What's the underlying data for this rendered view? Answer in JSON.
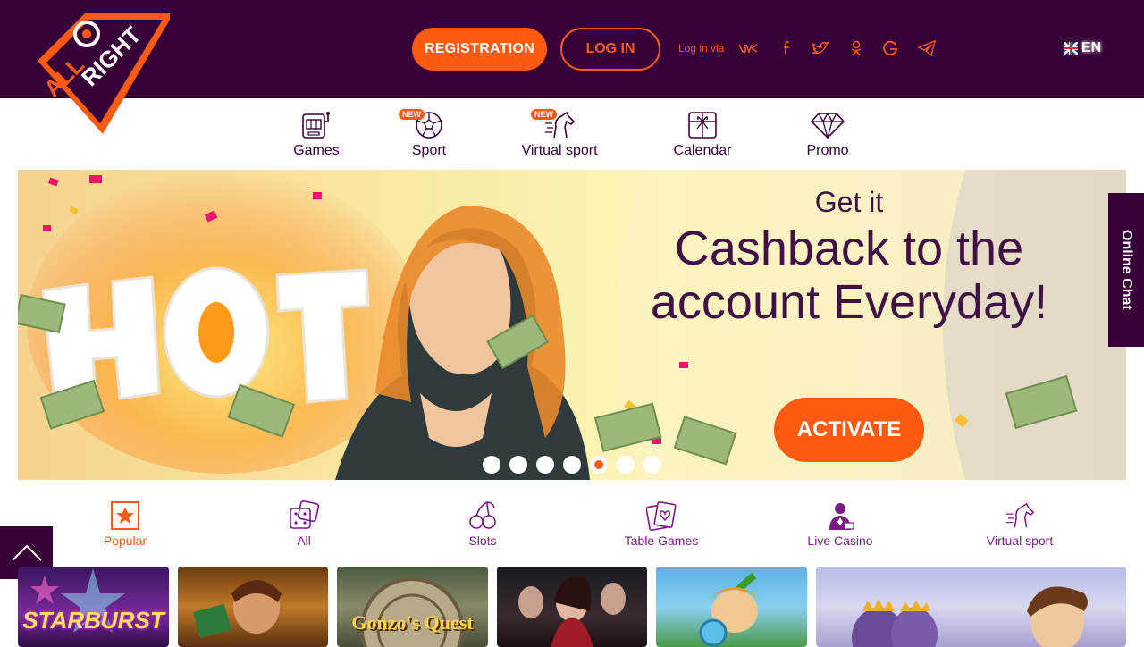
{
  "header": {
    "logo_text": "ALL RIGHT",
    "registration_label": "REGISTRATION",
    "login_label": "LOG IN",
    "login_via_label": "Log in via",
    "social_icons": [
      "vk-icon",
      "facebook-icon",
      "twitter-icon",
      "odnoklassniki-icon",
      "google-icon",
      "telegram-icon"
    ],
    "language": "EN"
  },
  "nav": {
    "items": [
      {
        "label": "Games",
        "icon": "slot-machine-icon"
      },
      {
        "label": "Sport",
        "icon": "soccer-ball-icon",
        "badge": "NEW"
      },
      {
        "label": "Virtual sport",
        "icon": "horse-icon",
        "badge": "NEW"
      },
      {
        "label": "Calendar",
        "icon": "gift-calendar-icon"
      },
      {
        "label": "Promo",
        "icon": "diamond-icon"
      }
    ]
  },
  "banner": {
    "hot_text": "HOT",
    "subtitle": "Get it",
    "title": "Cashback to the account Everyday!",
    "button_label": "ACTIVATE",
    "slide_count": 7,
    "active_slide": 5
  },
  "online_chat_label": "Online Chat",
  "categories": [
    {
      "label": "Popular",
      "icon": "star-icon",
      "active": true
    },
    {
      "label": "All",
      "icon": "dice-icon"
    },
    {
      "label": "Slots",
      "icon": "cherry-icon"
    },
    {
      "label": "Table Games",
      "icon": "cards-icon"
    },
    {
      "label": "Live Casino",
      "icon": "dealer-icon"
    },
    {
      "label": "Virtual sport",
      "icon": "horse-icon"
    }
  ],
  "games": [
    {
      "title": "STARBURST"
    },
    {
      "title": ""
    },
    {
      "title": "Gonzo's Quest"
    },
    {
      "title": ""
    },
    {
      "title": ""
    },
    {
      "title": ""
    }
  ],
  "colors": {
    "brand_dark": "#380038",
    "accent": "#ff5a12",
    "text_purple": "#3f1146"
  }
}
